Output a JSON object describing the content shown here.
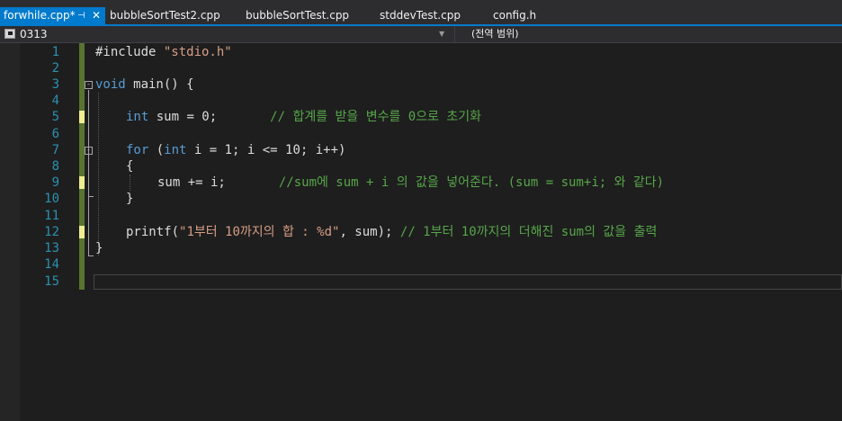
{
  "tabs": [
    {
      "label": "forwhile.cpp*",
      "active": true,
      "pin": "⊣",
      "close": "✕"
    },
    {
      "label": "bubbleSortTest2.cpp"
    },
    {
      "label": "bubbleSortTest.cpp"
    },
    {
      "label": "stddevTest.cpp"
    },
    {
      "label": "config.h"
    }
  ],
  "navbar": {
    "project": "0313",
    "scope": "(전역 범위)",
    "dropdown_icon": "chevron-down-icon"
  },
  "editor": {
    "line_numbers": [
      "1",
      "2",
      "3",
      "4",
      "5",
      "6",
      "7",
      "8",
      "9",
      "10",
      "11",
      "12",
      "13",
      "14",
      "15"
    ],
    "code": {
      "l1_directive": "#include ",
      "l1_header": "\"stdio.h\"",
      "l3_kw": "void",
      "l3_rest": " main() {",
      "l5_kw": "int",
      "l5_rest": " sum = 0;       ",
      "l5_comment": "// 합계를 받을 변수를 0으로 초기화",
      "l7_kw1": "for",
      "l7_mid": " (",
      "l7_kw2": "int",
      "l7_rest": " i = 1; i <= 10; i++)",
      "l8": "{",
      "l9_code": "sum += i;       ",
      "l9_comment": "//sum에 sum + i 의 값을 넣어준다. (sum = sum+i; 와 같다)",
      "l10": "}",
      "l12_fn": "printf(",
      "l12_str": "\"1부터 10까지의 합 : %d\"",
      "l12_rest": ", sum); ",
      "l12_comment": "// 1부터 10까지의 더해진 sum의 값을 출력",
      "l13": "}"
    }
  },
  "colors": {
    "accent": "#007acc",
    "keyword": "#569cd6",
    "string": "#d69d85",
    "comment": "#57a64a",
    "line_number": "#2b91af",
    "saved_change": "#577430",
    "unsaved_change": "#efef91"
  }
}
